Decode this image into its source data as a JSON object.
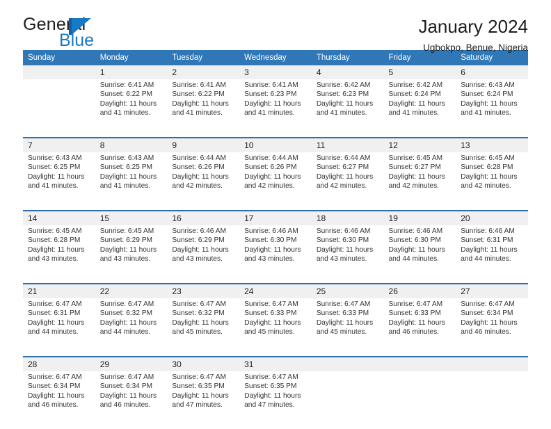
{
  "brand": {
    "name_part1": "General",
    "name_part2": "Blue"
  },
  "header": {
    "title": "January 2024",
    "subtitle": "Ugbokpo, Benue, Nigeria"
  },
  "colors": {
    "header_blue": "#3077b8",
    "divider_blue": "#2f6fae",
    "daynum_band": "#f0f0f0",
    "logo_blue": "#1879c4"
  },
  "day_headers": [
    "Sunday",
    "Monday",
    "Tuesday",
    "Wednesday",
    "Thursday",
    "Friday",
    "Saturday"
  ],
  "weeks": [
    [
      {
        "day": "",
        "lines": []
      },
      {
        "day": "1",
        "lines": [
          "Sunrise: 6:41 AM",
          "Sunset: 6:22 PM",
          "Daylight: 11 hours",
          "and 41 minutes."
        ]
      },
      {
        "day": "2",
        "lines": [
          "Sunrise: 6:41 AM",
          "Sunset: 6:22 PM",
          "Daylight: 11 hours",
          "and 41 minutes."
        ]
      },
      {
        "day": "3",
        "lines": [
          "Sunrise: 6:41 AM",
          "Sunset: 6:23 PM",
          "Daylight: 11 hours",
          "and 41 minutes."
        ]
      },
      {
        "day": "4",
        "lines": [
          "Sunrise: 6:42 AM",
          "Sunset: 6:23 PM",
          "Daylight: 11 hours",
          "and 41 minutes."
        ]
      },
      {
        "day": "5",
        "lines": [
          "Sunrise: 6:42 AM",
          "Sunset: 6:24 PM",
          "Daylight: 11 hours",
          "and 41 minutes."
        ]
      },
      {
        "day": "6",
        "lines": [
          "Sunrise: 6:43 AM",
          "Sunset: 6:24 PM",
          "Daylight: 11 hours",
          "and 41 minutes."
        ]
      }
    ],
    [
      {
        "day": "7",
        "lines": [
          "Sunrise: 6:43 AM",
          "Sunset: 6:25 PM",
          "Daylight: 11 hours",
          "and 41 minutes."
        ]
      },
      {
        "day": "8",
        "lines": [
          "Sunrise: 6:43 AM",
          "Sunset: 6:25 PM",
          "Daylight: 11 hours",
          "and 41 minutes."
        ]
      },
      {
        "day": "9",
        "lines": [
          "Sunrise: 6:44 AM",
          "Sunset: 6:26 PM",
          "Daylight: 11 hours",
          "and 42 minutes."
        ]
      },
      {
        "day": "10",
        "lines": [
          "Sunrise: 6:44 AM",
          "Sunset: 6:26 PM",
          "Daylight: 11 hours",
          "and 42 minutes."
        ]
      },
      {
        "day": "11",
        "lines": [
          "Sunrise: 6:44 AM",
          "Sunset: 6:27 PM",
          "Daylight: 11 hours",
          "and 42 minutes."
        ]
      },
      {
        "day": "12",
        "lines": [
          "Sunrise: 6:45 AM",
          "Sunset: 6:27 PM",
          "Daylight: 11 hours",
          "and 42 minutes."
        ]
      },
      {
        "day": "13",
        "lines": [
          "Sunrise: 6:45 AM",
          "Sunset: 6:28 PM",
          "Daylight: 11 hours",
          "and 42 minutes."
        ]
      }
    ],
    [
      {
        "day": "14",
        "lines": [
          "Sunrise: 6:45 AM",
          "Sunset: 6:28 PM",
          "Daylight: 11 hours",
          "and 43 minutes."
        ]
      },
      {
        "day": "15",
        "lines": [
          "Sunrise: 6:45 AM",
          "Sunset: 6:29 PM",
          "Daylight: 11 hours",
          "and 43 minutes."
        ]
      },
      {
        "day": "16",
        "lines": [
          "Sunrise: 6:46 AM",
          "Sunset: 6:29 PM",
          "Daylight: 11 hours",
          "and 43 minutes."
        ]
      },
      {
        "day": "17",
        "lines": [
          "Sunrise: 6:46 AM",
          "Sunset: 6:30 PM",
          "Daylight: 11 hours",
          "and 43 minutes."
        ]
      },
      {
        "day": "18",
        "lines": [
          "Sunrise: 6:46 AM",
          "Sunset: 6:30 PM",
          "Daylight: 11 hours",
          "and 43 minutes."
        ]
      },
      {
        "day": "19",
        "lines": [
          "Sunrise: 6:46 AM",
          "Sunset: 6:30 PM",
          "Daylight: 11 hours",
          "and 44 minutes."
        ]
      },
      {
        "day": "20",
        "lines": [
          "Sunrise: 6:46 AM",
          "Sunset: 6:31 PM",
          "Daylight: 11 hours",
          "and 44 minutes."
        ]
      }
    ],
    [
      {
        "day": "21",
        "lines": [
          "Sunrise: 6:47 AM",
          "Sunset: 6:31 PM",
          "Daylight: 11 hours",
          "and 44 minutes."
        ]
      },
      {
        "day": "22",
        "lines": [
          "Sunrise: 6:47 AM",
          "Sunset: 6:32 PM",
          "Daylight: 11 hours",
          "and 44 minutes."
        ]
      },
      {
        "day": "23",
        "lines": [
          "Sunrise: 6:47 AM",
          "Sunset: 6:32 PM",
          "Daylight: 11 hours",
          "and 45 minutes."
        ]
      },
      {
        "day": "24",
        "lines": [
          "Sunrise: 6:47 AM",
          "Sunset: 6:33 PM",
          "Daylight: 11 hours",
          "and 45 minutes."
        ]
      },
      {
        "day": "25",
        "lines": [
          "Sunrise: 6:47 AM",
          "Sunset: 6:33 PM",
          "Daylight: 11 hours",
          "and 45 minutes."
        ]
      },
      {
        "day": "26",
        "lines": [
          "Sunrise: 6:47 AM",
          "Sunset: 6:33 PM",
          "Daylight: 11 hours",
          "and 46 minutes."
        ]
      },
      {
        "day": "27",
        "lines": [
          "Sunrise: 6:47 AM",
          "Sunset: 6:34 PM",
          "Daylight: 11 hours",
          "and 46 minutes."
        ]
      }
    ],
    [
      {
        "day": "28",
        "lines": [
          "Sunrise: 6:47 AM",
          "Sunset: 6:34 PM",
          "Daylight: 11 hours",
          "and 46 minutes."
        ]
      },
      {
        "day": "29",
        "lines": [
          "Sunrise: 6:47 AM",
          "Sunset: 6:34 PM",
          "Daylight: 11 hours",
          "and 46 minutes."
        ]
      },
      {
        "day": "30",
        "lines": [
          "Sunrise: 6:47 AM",
          "Sunset: 6:35 PM",
          "Daylight: 11 hours",
          "and 47 minutes."
        ]
      },
      {
        "day": "31",
        "lines": [
          "Sunrise: 6:47 AM",
          "Sunset: 6:35 PM",
          "Daylight: 11 hours",
          "and 47 minutes."
        ]
      },
      {
        "day": "",
        "lines": []
      },
      {
        "day": "",
        "lines": []
      },
      {
        "day": "",
        "lines": []
      }
    ]
  ]
}
